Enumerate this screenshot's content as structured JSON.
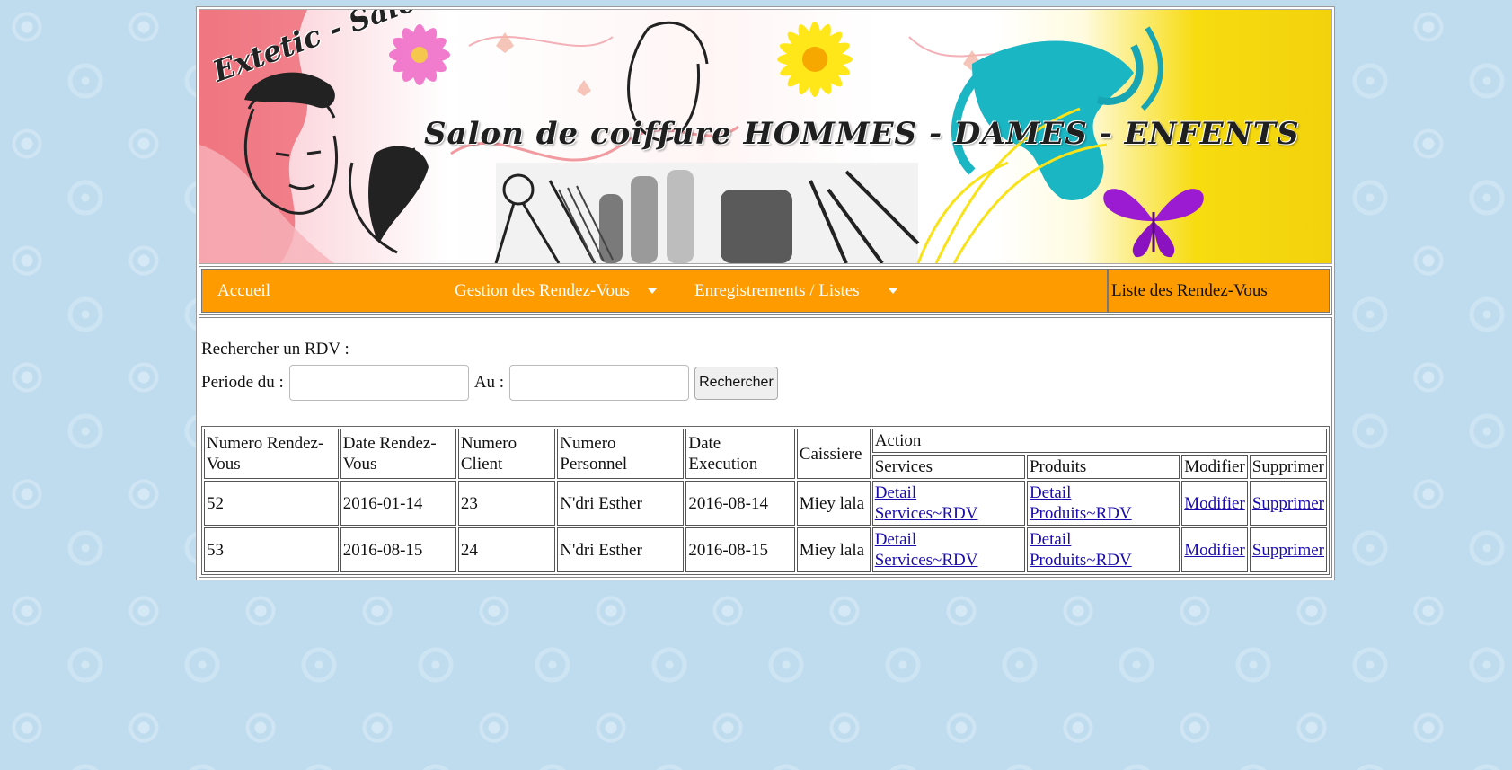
{
  "banner": {
    "brand": "Extetic - Salon",
    "title": "Salon de coiffure HOMMES - DAMES - ENFENTS"
  },
  "menu": {
    "items": [
      {
        "label": "Accueil"
      },
      {
        "label": "Gestion des Rendez-Vous"
      },
      {
        "label": "Enregistrements / Listes"
      }
    ],
    "current": "Liste des Rendez-Vous"
  },
  "search": {
    "heading": "Rechercher un RDV :",
    "from_label": "Periode du :",
    "to_label": "Au :",
    "button": "Rechercher"
  },
  "table": {
    "headers": {
      "numero_rdv": "Numero Rendez-Vous",
      "date_rdv": "Date Rendez-Vous",
      "numero_client": "Numero Client",
      "numero_personnel": "Numero Personnel",
      "date_execution": "Date Execution",
      "caissiere": "Caissiere",
      "action": "Action",
      "services": "Services",
      "produits": "Produits",
      "modifier": "Modifier",
      "supprimer": "Supprimer"
    },
    "rows": [
      {
        "numero": "52",
        "date_rdv": "2016-01-14",
        "client": "23",
        "personnel": "N'dri Esther",
        "date_execution": "2016-08-14",
        "caissiere": "Miey lala",
        "services_link": "Detail Services~RDV",
        "produits_link": "Detail Produits~RDV",
        "modifier_link": "Modifier",
        "supprimer_link": "Supprimer"
      },
      {
        "numero": "53",
        "date_rdv": "2016-08-15",
        "client": "24",
        "personnel": "N'dri Esther",
        "date_execution": "2016-08-15",
        "caissiere": "Miey lala",
        "services_link": "Detail Services~RDV",
        "produits_link": "Detail Produits~RDV",
        "modifier_link": "Modifier",
        "supprimer_link": "Supprimer"
      }
    ]
  }
}
